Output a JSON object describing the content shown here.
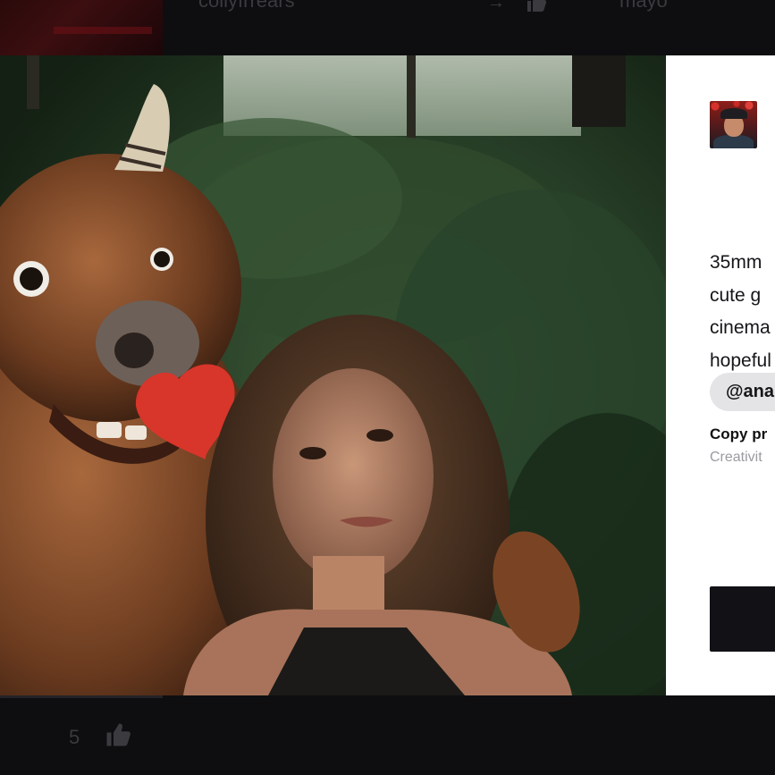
{
  "topbar": {
    "text_left": "collyfrrears",
    "text_right": "mayo"
  },
  "panel": {
    "prompt_lines": [
      "35mm",
      "cute g",
      "cinema",
      "hopeful"
    ],
    "tag": "@ana",
    "copy_label": "Copy pr",
    "copy_sub": "Creativit"
  },
  "bottombar": {
    "like_count": "5"
  },
  "icons": {
    "top_arrow": "arrow-icon",
    "top_like": "thumbs-up-icon",
    "bottom_like": "thumbs-up-icon"
  },
  "colors": {
    "background": "#0d0d0f",
    "panel": "#ffffff",
    "tag_bg": "#e4e4e6",
    "cta": "#111116"
  }
}
